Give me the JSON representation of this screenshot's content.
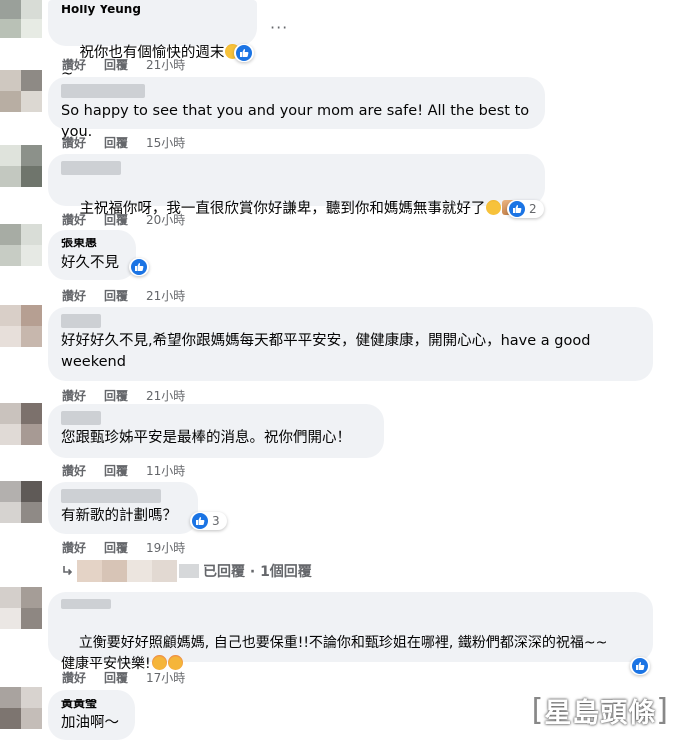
{
  "comments": [
    {
      "name_partial": "Holly Yeung",
      "text": "祝你也有個愉快的週末",
      "suffix": "~",
      "actions": {
        "like": "讚好",
        "reply": "回覆",
        "time": "21小時"
      }
    },
    {
      "name_partial": "",
      "text": "So happy to see that you and your mom are safe! All the best to you.",
      "actions": {
        "like": "讚好",
        "reply": "回覆",
        "time": "15小時"
      }
    },
    {
      "name_partial": "",
      "text": "主祝福你呀，我一直很欣賞你好謙卑，聽到你和媽媽無事就好了",
      "reaction_count": "2",
      "actions": {
        "like": "讚好",
        "reply": "回覆",
        "time": "20小時"
      }
    },
    {
      "name_partial": "張東惠",
      "text": "好久不見",
      "actions": {
        "like": "讚好",
        "reply": "回覆",
        "time": "21小時"
      }
    },
    {
      "name_partial": "",
      "text": "好好好久不見,希望你跟媽媽每天都平平安安，健健康康，開開心心，have a good\nweekend",
      "actions": {
        "like": "讚好",
        "reply": "回覆",
        "time": "21小時"
      }
    },
    {
      "name_partial": "",
      "text": "您跟甄珍姊平安是最棒的消息。祝你們開心！",
      "actions": {
        "like": "讚好",
        "reply": "回覆",
        "time": "11小時"
      }
    },
    {
      "name_partial": "",
      "text": "有新歌的計劃嗎？",
      "reaction_count": "3",
      "actions": {
        "like": "讚好",
        "reply": "回覆",
        "time": "19小時"
      }
    },
    {
      "name_partial": "",
      "text": "立衡要好好照顧媽媽, 自己也要保重!!不論你和甄珍姐在哪裡, 鐵粉們都深深的祝福~~\n健康平安快樂!",
      "actions": {
        "like": "讚好",
        "reply": "回覆",
        "time": "17小時"
      }
    },
    {
      "name_partial": "黃黃瑩",
      "text": "加油啊～"
    }
  ],
  "reply_summary": "已回覆 · 1個回覆",
  "more_menu": "···",
  "watermark": "星島頭條",
  "watermark_bracket_left": "[",
  "watermark_bracket_right": "]",
  "colors": {
    "bubble": "#f0f2f5",
    "like_blue": "#1b74e4",
    "meta_gray": "#65676b"
  },
  "icons": [
    "thumbs-up-icon",
    "grinning-face-icon",
    "folded-hands-icon",
    "smiling-face-with-hearts-icon",
    "reply-arrow-icon",
    "more-options-icon"
  ]
}
